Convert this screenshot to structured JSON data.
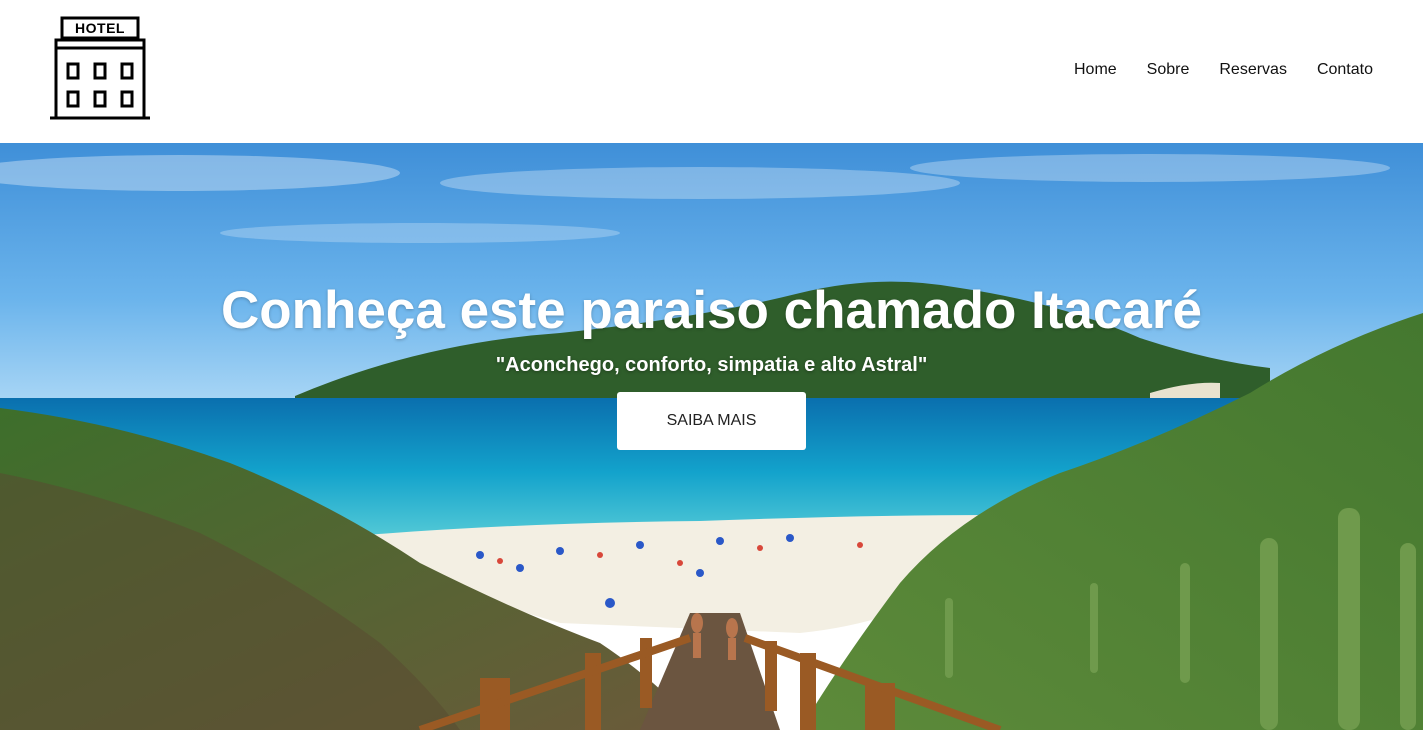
{
  "logo": {
    "label": "HOTEL"
  },
  "nav": {
    "items": [
      "Home",
      "Sobre",
      "Reservas",
      "Contato"
    ]
  },
  "hero": {
    "title": "Conheça este paraiso chamado Itacaré",
    "subtitle": "\"Aconchego, conforto, simpatia e alto Astral\"",
    "cta_label": "SAIBA MAIS"
  },
  "colors": {
    "header_bg": "#ffffff",
    "nav_text": "#111111",
    "hero_text": "#ffffff",
    "cta_bg": "#ffffff",
    "sky": "#5aa6e6",
    "sea": "#1aa0c8",
    "sand": "#f4f1e8",
    "vegetation": "#3f7a2e"
  },
  "icons": {
    "logo": "hotel-building-icon"
  }
}
